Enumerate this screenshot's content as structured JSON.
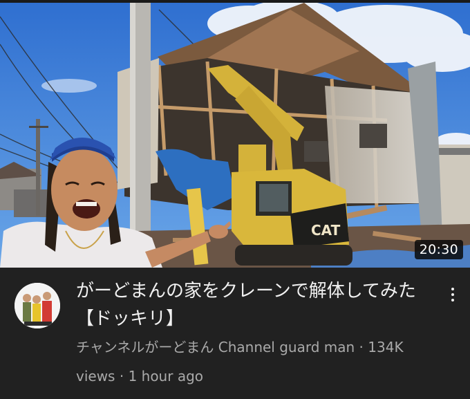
{
  "video": {
    "duration": "20:30",
    "title": "がーどまんの家をクレーンで解体してみた【ドッキリ】",
    "channel": "チャンネルがーどまん Channel guard man",
    "separator": " · ",
    "views": "134K views",
    "age": "1 hour ago"
  },
  "excavator": {
    "brand": "CAT"
  },
  "icons": {
    "menu": "more-vert-icon",
    "avatar": "channel-avatar"
  },
  "colors": {
    "background": "#212121",
    "title": "#f1f1f1",
    "subtitle": "#aaaaaa",
    "duration_bg": "#0a0a0a"
  }
}
